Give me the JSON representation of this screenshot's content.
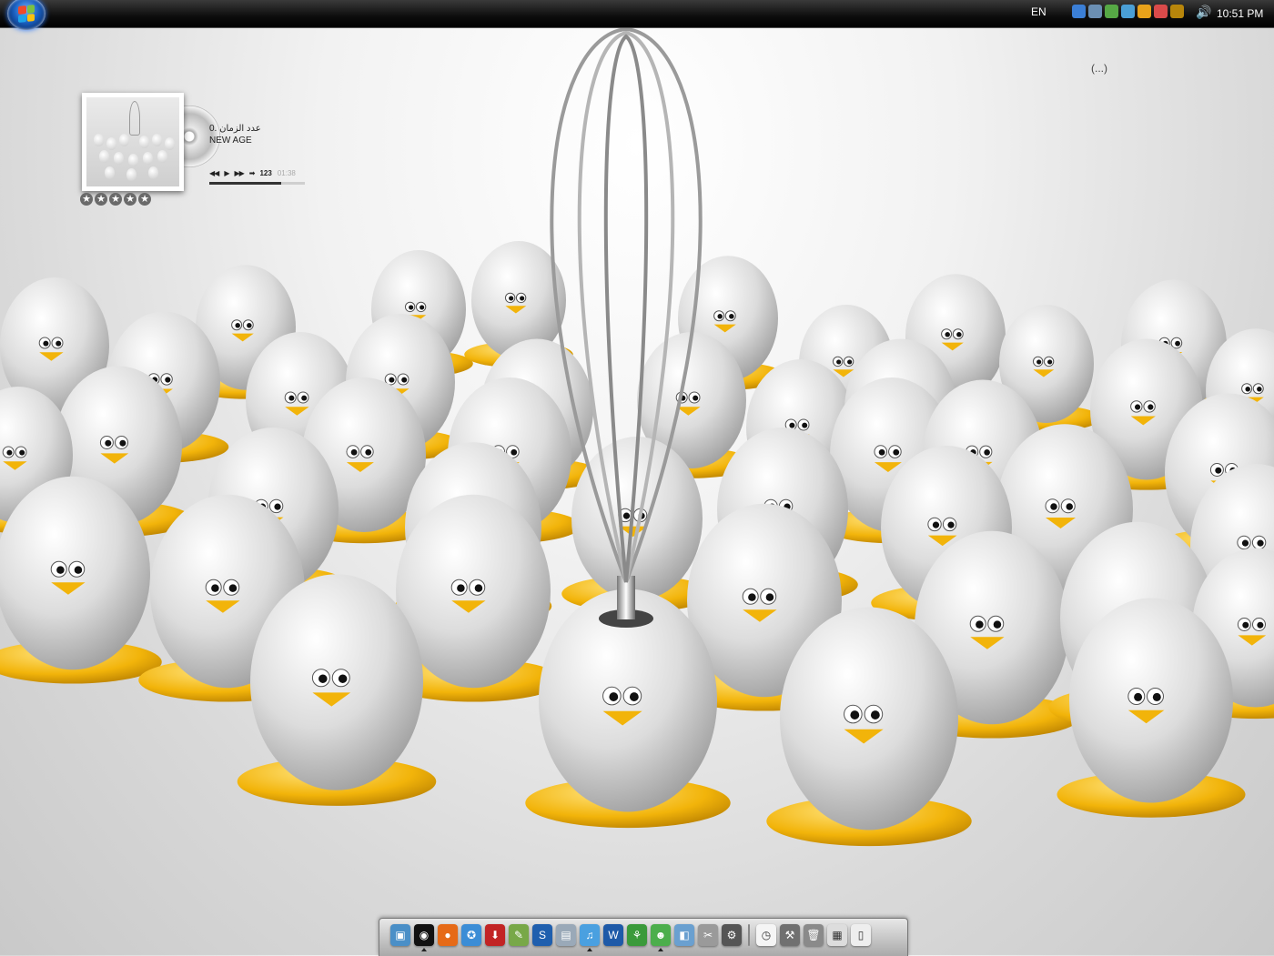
{
  "topbar": {
    "language": "EN",
    "clock": "10:51 PM",
    "tray_icons": [
      "messenger-icon",
      "network-icon",
      "user-icon",
      "display-icon",
      "windows-flag-icon",
      "eraser-icon",
      "word-icon"
    ],
    "volume_icon": "speaker-icon"
  },
  "corner_text": "(...)",
  "media_player": {
    "track_title": "0. عدد الزمان",
    "artist": "NEW AGE",
    "track_number": "123",
    "time": "01:38",
    "progress": 0.75,
    "rating_stars": 5
  },
  "dock": {
    "icons": [
      {
        "name": "desktop-icon",
        "color": "#4a8fc7",
        "glyph": "▣",
        "running": false
      },
      {
        "name": "media-player-icon",
        "color": "#111111",
        "glyph": "◉",
        "running": true
      },
      {
        "name": "firefox-icon",
        "color": "#e66a17",
        "glyph": "●",
        "running": false
      },
      {
        "name": "safari-icon",
        "color": "#3b8dd6",
        "glyph": "✪",
        "running": false
      },
      {
        "name": "downloader-icon",
        "color": "#c22424",
        "glyph": "⬇",
        "running": false
      },
      {
        "name": "editor-icon",
        "color": "#78a848",
        "glyph": "✎",
        "running": false
      },
      {
        "name": "skype-icon",
        "color": "#1f5fae",
        "glyph": "S",
        "running": false
      },
      {
        "name": "notepad-icon",
        "color": "#9aa9b8",
        "glyph": "▤",
        "running": false
      },
      {
        "name": "itunes-icon",
        "color": "#4aa0e0",
        "glyph": "♫",
        "running": true
      },
      {
        "name": "word-icon",
        "color": "#1e5aa8",
        "glyph": "W",
        "running": false
      },
      {
        "name": "network-tool-icon",
        "color": "#3a9a3a",
        "glyph": "⚘",
        "running": false
      },
      {
        "name": "messenger-icon",
        "color": "#4cae4c",
        "glyph": "☻",
        "running": true
      },
      {
        "name": "photo-icon",
        "color": "#6aa0d0",
        "glyph": "◧",
        "running": false
      },
      {
        "name": "scissors-icon",
        "color": "#9a9a9a",
        "glyph": "✂",
        "running": false
      },
      {
        "name": "system-icon",
        "color": "#555555",
        "glyph": "⚙",
        "running": false
      },
      {
        "name": "separator",
        "color": "",
        "glyph": "",
        "running": false
      },
      {
        "name": "clock-icon",
        "color": "#f5f5f5",
        "glyph": "◷",
        "running": false
      },
      {
        "name": "tools-icon",
        "color": "#707070",
        "glyph": "⚒",
        "running": false
      },
      {
        "name": "trash-icon",
        "color": "#8a8a8a",
        "glyph": "🗑",
        "running": false
      },
      {
        "name": "calendar-icon",
        "color": "#dddddd",
        "glyph": "▦",
        "running": false
      },
      {
        "name": "document-icon",
        "color": "#eeeeee",
        "glyph": "▯",
        "running": false
      }
    ]
  }
}
